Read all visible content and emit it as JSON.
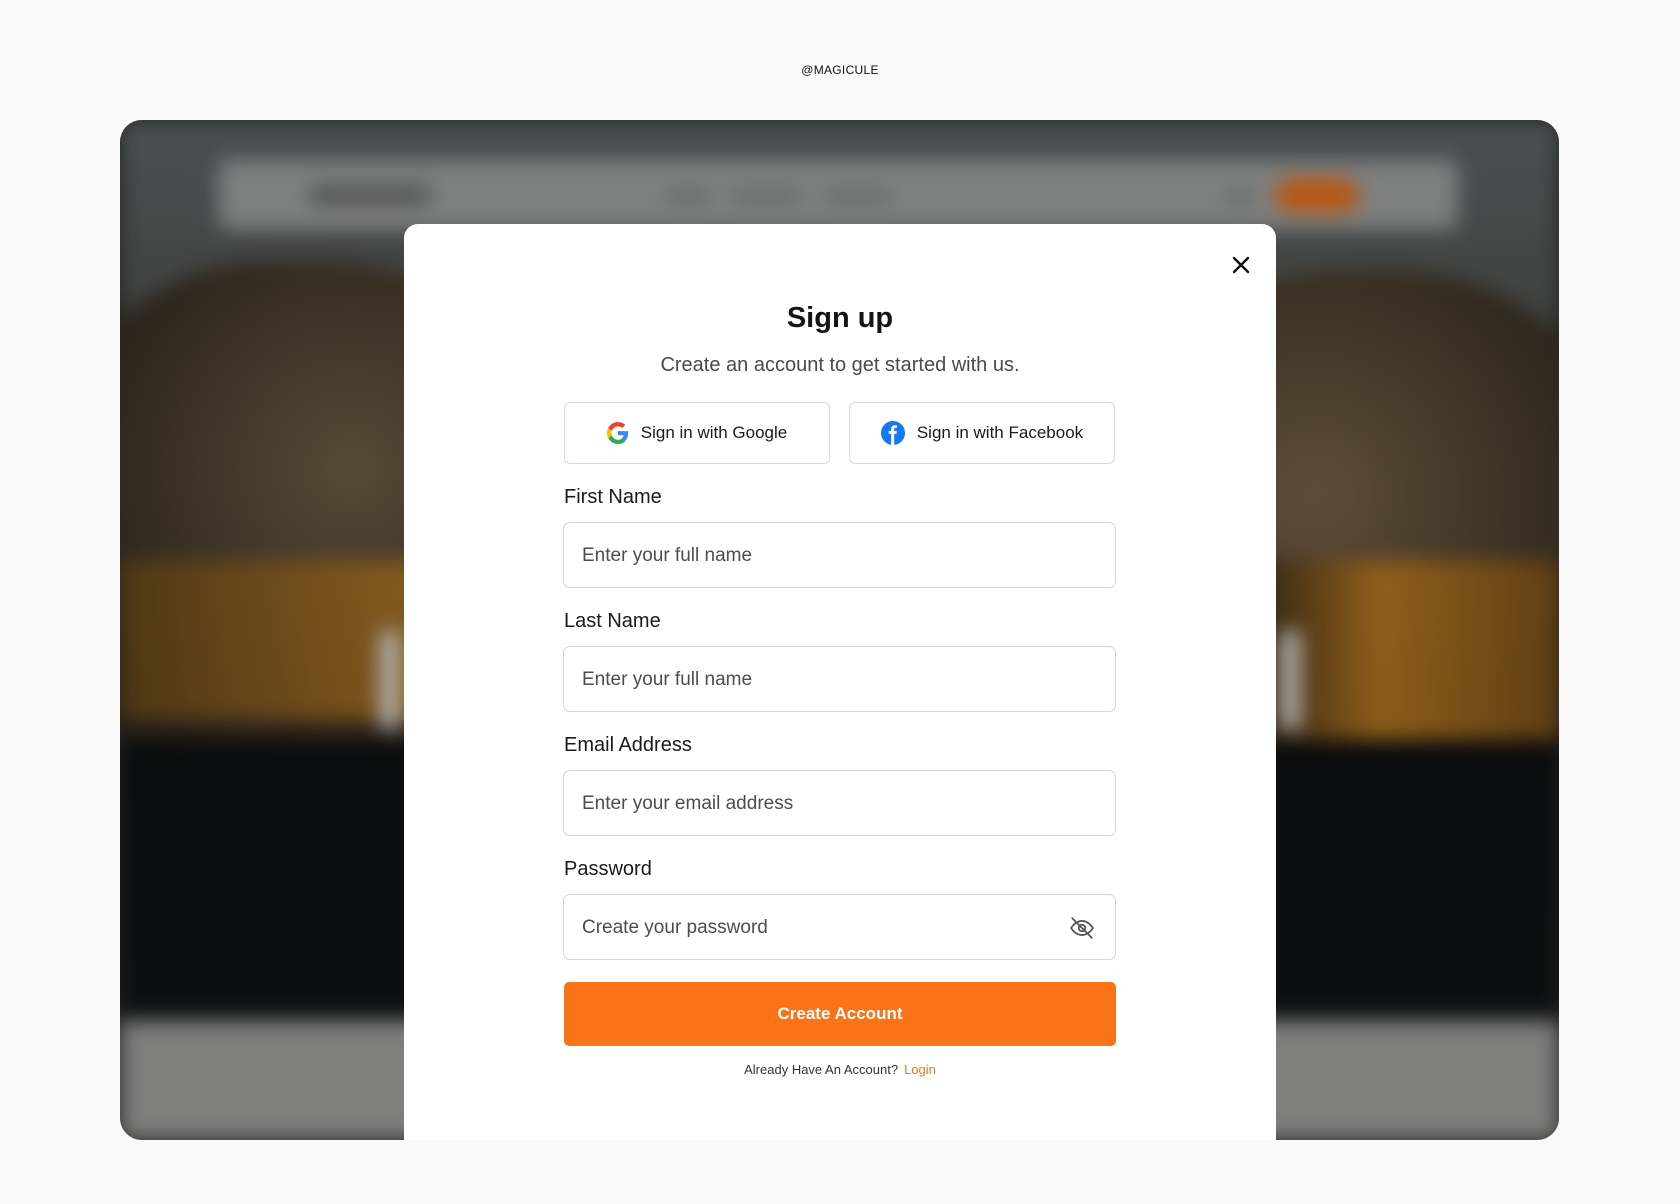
{
  "watermark": "@MAGICULE",
  "modal": {
    "title": "Sign up",
    "subtitle": "Create an account to get started with us.",
    "google_button": "Sign in with Google",
    "facebook_button": "Sign in with Facebook",
    "fields": {
      "first_name": {
        "label": "First Name",
        "placeholder": "Enter your full name",
        "value": ""
      },
      "last_name": {
        "label": "Last Name",
        "placeholder": "Enter your full name",
        "value": ""
      },
      "email": {
        "label": "Email Address",
        "placeholder": "Enter your email address",
        "value": ""
      },
      "password": {
        "label": "Password",
        "placeholder": "Create your password",
        "value": "",
        "visibility_icon": "eye-off-icon"
      }
    },
    "submit_label": "Create Account",
    "footer": {
      "prompt": "Already Have An Account?",
      "link": "Login"
    },
    "close_icon": "close-icon"
  },
  "colors": {
    "accent": "#fa7317",
    "page_background": "#f9f9f9",
    "google_blue": "#4285F4",
    "facebook_blue": "#1877F2"
  }
}
